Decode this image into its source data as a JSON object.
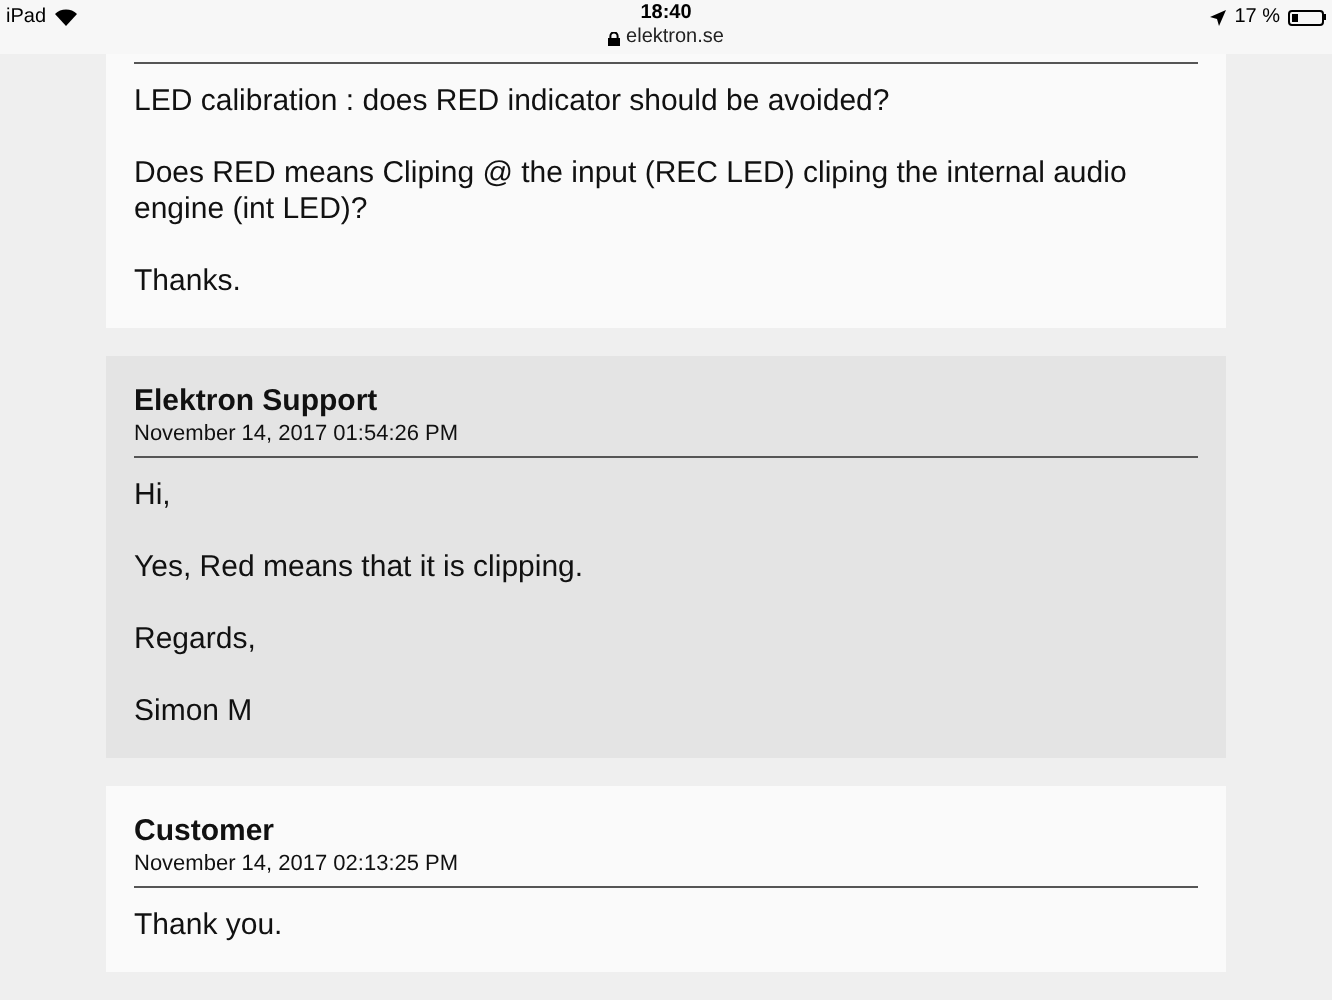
{
  "status_bar": {
    "device": "iPad",
    "time": "18:40",
    "url": "elektron.se",
    "battery": "17 %"
  },
  "messages": [
    {
      "highlighted": false,
      "paragraphs": [
        "LED calibration : does RED indicator should be avoided?",
        "Does RED means Cliping @ the input (REC LED) cliping the internal audio engine (int LED)?",
        "Thanks."
      ]
    },
    {
      "highlighted": true,
      "author": "Elektron Support",
      "date": "November 14, 2017 01:54:26 PM",
      "paragraphs": [
        "Hi,",
        "Yes, Red means that it is clipping.",
        "Regards,",
        "Simon M"
      ]
    },
    {
      "highlighted": false,
      "author": "Customer",
      "date": "November 14, 2017 02:13:25 PM",
      "paragraphs": [
        "Thank you."
      ]
    }
  ]
}
